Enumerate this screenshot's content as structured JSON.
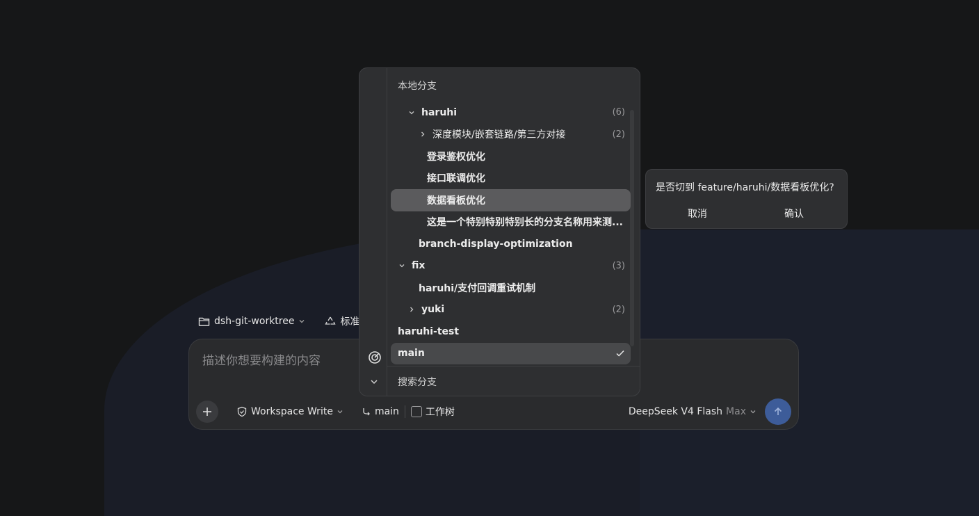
{
  "workspace": {
    "folder": "dsh-git-worktree",
    "mode": "标准模式"
  },
  "composer": {
    "placeholder": "描述你想要构建的内容",
    "permission": "Workspace Write",
    "branch": "main",
    "worktree_label": "工作树",
    "model": "DeepSeek V4 Flash",
    "model_tier": "Max"
  },
  "branch_menu": {
    "header": "本地分支",
    "search": "搜索分支",
    "rows": [
      {
        "label": "haruhi",
        "count": "(6)",
        "depth": 1,
        "chevron": "down"
      },
      {
        "label": "深度模块/嵌套链路/第三方对接",
        "count": "(2)",
        "depth": 2,
        "chevron": "right"
      },
      {
        "label": "登录鉴权优化",
        "depth": 3
      },
      {
        "label": "接口联调优化",
        "depth": 3
      },
      {
        "label": "数据看板优化",
        "depth": 3,
        "highlight": true
      },
      {
        "label": "这是一个特别特别特别长的分支名称用来测...",
        "depth": 3
      },
      {
        "label": "branch-display-optimization",
        "depth": 2
      },
      {
        "label": "fix",
        "count": "(3)",
        "depth": 0,
        "chevron": "down"
      },
      {
        "label": "haruhi/支付回调重试机制",
        "depth": 2
      },
      {
        "label": "yuki",
        "count": "(2)",
        "depth": 1,
        "chevron": "right"
      },
      {
        "label": "haruhi-test",
        "depth": 0
      },
      {
        "label": "main",
        "depth": 0,
        "current": true
      }
    ]
  },
  "confirm": {
    "message": "是否切到 feature/haruhi/数据看板优化?",
    "cancel": "取消",
    "ok": "确认"
  },
  "colors": {
    "send_button": "#3d5c99",
    "highlight": "#5b5b5d",
    "panel": "#2e2f31"
  }
}
